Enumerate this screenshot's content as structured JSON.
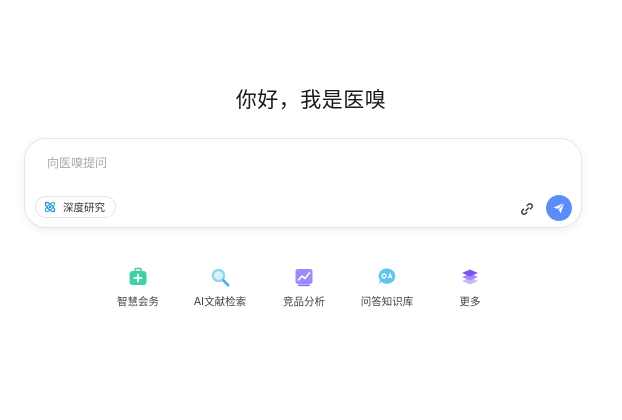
{
  "greeting": "你好，我是医嗅",
  "chat": {
    "placeholder": "向医嗅提问",
    "deep_research_label": "深度研究",
    "deep_research_icon": "atom-icon",
    "attach_icon": "link-icon",
    "send_icon": "send-icon",
    "send_color": "#5b8df6"
  },
  "features": [
    {
      "label": "智慧会务",
      "icon": "medical-kit-icon",
      "color": "#3fd0a8"
    },
    {
      "label": "AI文献检索",
      "icon": "search-doc-icon",
      "color": "#3fb6e0"
    },
    {
      "label": "竞品分析",
      "icon": "trend-chart-icon",
      "color": "#7b6cf0"
    },
    {
      "label": "问答知识库",
      "icon": "qa-bubble-icon",
      "color": "#40b8e8"
    },
    {
      "label": "更多",
      "icon": "layers-icon",
      "color": "#7a55f0"
    }
  ]
}
